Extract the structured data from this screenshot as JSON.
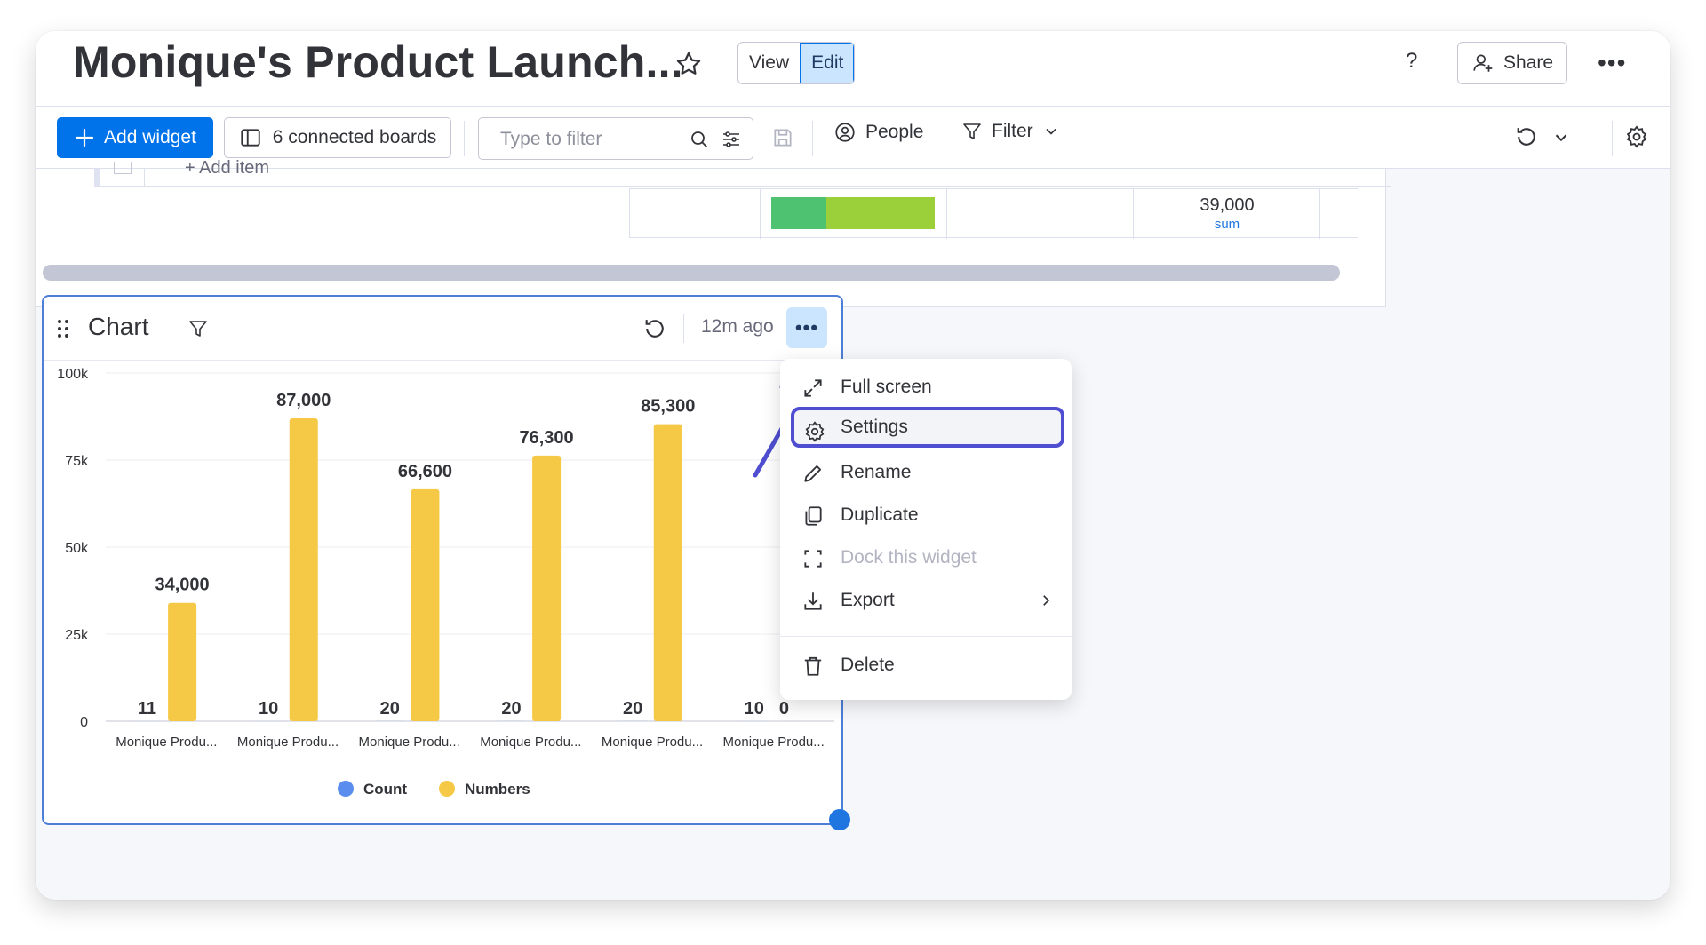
{
  "header": {
    "title": "Monique's Product Launch...",
    "view_label": "View",
    "edit_label": "Edit",
    "help_label": "?",
    "share_label": "Share"
  },
  "toolbar": {
    "add_widget_label": "Add widget",
    "connected_boards_label": "6 connected boards",
    "filter_placeholder": "Type to filter",
    "people_label": "People",
    "filter_label": "Filter"
  },
  "board": {
    "add_item_label": "+ Add item",
    "sum_value": "39,000",
    "sum_label": "sum",
    "status_colors": [
      "#4fc271",
      "#9cd03b"
    ]
  },
  "widget": {
    "title": "Chart",
    "updated": "12m ago"
  },
  "chart_data": {
    "type": "bar",
    "categories": [
      "Monique Produ...",
      "Monique Produ...",
      "Monique Produ...",
      "Monique Produ...",
      "Monique Produ...",
      "Monique Produ..."
    ],
    "series": [
      {
        "name": "Count",
        "color": "#5b8def",
        "values": [
          11,
          10,
          20,
          20,
          20,
          10
        ]
      },
      {
        "name": "Numbers",
        "color": "#f5c945",
        "values": [
          34000,
          87000,
          66600,
          76300,
          85300,
          0
        ]
      }
    ],
    "count_labels": [
      "11",
      "10",
      "20",
      "20",
      "20",
      "10"
    ],
    "numbers_labels": [
      "34,000",
      "87,000",
      "66,600",
      "76,300",
      "85,300",
      "0"
    ],
    "yticks": [
      "100k",
      "75k",
      "50k",
      "25k",
      "0"
    ],
    "ylim": [
      0,
      100000
    ],
    "grid": true,
    "legend_position": "bottom"
  },
  "menu": {
    "items": [
      {
        "label": "Full screen",
        "icon": "expand-icon"
      },
      {
        "label": "Settings",
        "icon": "gear-icon"
      },
      {
        "label": "Rename",
        "icon": "pencil-icon"
      },
      {
        "label": "Duplicate",
        "icon": "duplicate-icon"
      },
      {
        "label": "Dock this widget",
        "icon": "dock-icon"
      },
      {
        "label": "Export",
        "icon": "download-icon"
      },
      {
        "label": "Delete",
        "icon": "trash-icon"
      }
    ]
  },
  "colors": {
    "accent": "#0073ea",
    "annotation": "#4f4ed0"
  }
}
